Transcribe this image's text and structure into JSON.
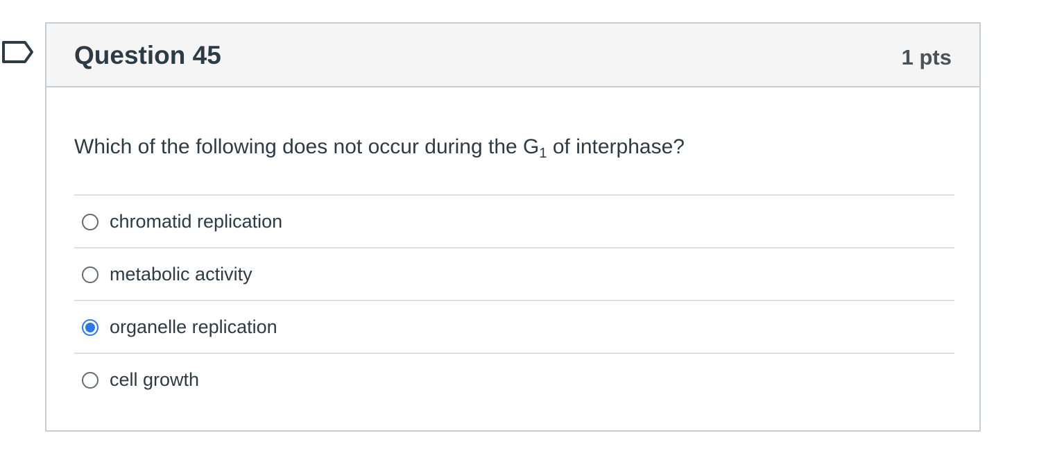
{
  "question": {
    "title": "Question 45",
    "points": "1 pts",
    "text_before_subscript": "Which of the following does not occur during the G",
    "subscript": "1",
    "text_after_subscript": " of interphase?",
    "flag_icon": "flag-outline-icon"
  },
  "answers": [
    {
      "label": "chromatid replication",
      "selected": false
    },
    {
      "label": "metabolic activity",
      "selected": false
    },
    {
      "label": "organelle replication",
      "selected": true
    },
    {
      "label": "cell growth",
      "selected": false
    }
  ],
  "colors": {
    "selected_radio": "#2b7ae4",
    "header_background": "#f5f5f5",
    "border": "#c7cdd1",
    "text": "#2d3b45"
  }
}
